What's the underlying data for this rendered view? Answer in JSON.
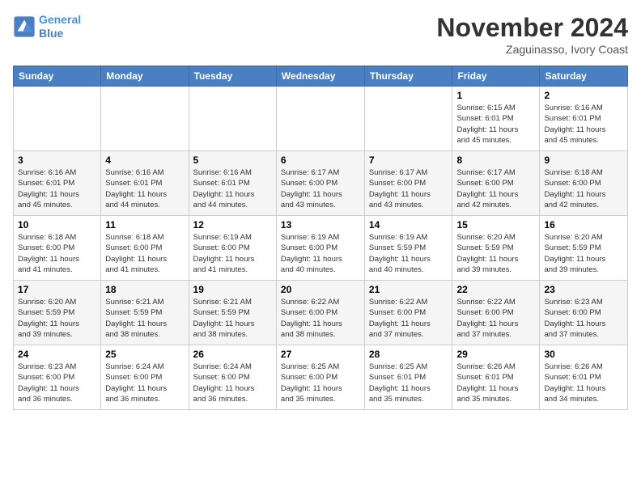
{
  "header": {
    "logo_line1": "General",
    "logo_line2": "Blue",
    "month_title": "November 2024",
    "location": "Zaguinasso, Ivory Coast"
  },
  "days_of_week": [
    "Sunday",
    "Monday",
    "Tuesday",
    "Wednesday",
    "Thursday",
    "Friday",
    "Saturday"
  ],
  "weeks": [
    [
      {
        "num": "",
        "info": ""
      },
      {
        "num": "",
        "info": ""
      },
      {
        "num": "",
        "info": ""
      },
      {
        "num": "",
        "info": ""
      },
      {
        "num": "",
        "info": ""
      },
      {
        "num": "1",
        "info": "Sunrise: 6:15 AM\nSunset: 6:01 PM\nDaylight: 11 hours\nand 45 minutes."
      },
      {
        "num": "2",
        "info": "Sunrise: 6:16 AM\nSunset: 6:01 PM\nDaylight: 11 hours\nand 45 minutes."
      }
    ],
    [
      {
        "num": "3",
        "info": "Sunrise: 6:16 AM\nSunset: 6:01 PM\nDaylight: 11 hours\nand 45 minutes."
      },
      {
        "num": "4",
        "info": "Sunrise: 6:16 AM\nSunset: 6:01 PM\nDaylight: 11 hours\nand 44 minutes."
      },
      {
        "num": "5",
        "info": "Sunrise: 6:16 AM\nSunset: 6:01 PM\nDaylight: 11 hours\nand 44 minutes."
      },
      {
        "num": "6",
        "info": "Sunrise: 6:17 AM\nSunset: 6:00 PM\nDaylight: 11 hours\nand 43 minutes."
      },
      {
        "num": "7",
        "info": "Sunrise: 6:17 AM\nSunset: 6:00 PM\nDaylight: 11 hours\nand 43 minutes."
      },
      {
        "num": "8",
        "info": "Sunrise: 6:17 AM\nSunset: 6:00 PM\nDaylight: 11 hours\nand 42 minutes."
      },
      {
        "num": "9",
        "info": "Sunrise: 6:18 AM\nSunset: 6:00 PM\nDaylight: 11 hours\nand 42 minutes."
      }
    ],
    [
      {
        "num": "10",
        "info": "Sunrise: 6:18 AM\nSunset: 6:00 PM\nDaylight: 11 hours\nand 41 minutes."
      },
      {
        "num": "11",
        "info": "Sunrise: 6:18 AM\nSunset: 6:00 PM\nDaylight: 11 hours\nand 41 minutes."
      },
      {
        "num": "12",
        "info": "Sunrise: 6:19 AM\nSunset: 6:00 PM\nDaylight: 11 hours\nand 41 minutes."
      },
      {
        "num": "13",
        "info": "Sunrise: 6:19 AM\nSunset: 6:00 PM\nDaylight: 11 hours\nand 40 minutes."
      },
      {
        "num": "14",
        "info": "Sunrise: 6:19 AM\nSunset: 5:59 PM\nDaylight: 11 hours\nand 40 minutes."
      },
      {
        "num": "15",
        "info": "Sunrise: 6:20 AM\nSunset: 5:59 PM\nDaylight: 11 hours\nand 39 minutes."
      },
      {
        "num": "16",
        "info": "Sunrise: 6:20 AM\nSunset: 5:59 PM\nDaylight: 11 hours\nand 39 minutes."
      }
    ],
    [
      {
        "num": "17",
        "info": "Sunrise: 6:20 AM\nSunset: 5:59 PM\nDaylight: 11 hours\nand 39 minutes."
      },
      {
        "num": "18",
        "info": "Sunrise: 6:21 AM\nSunset: 5:59 PM\nDaylight: 11 hours\nand 38 minutes."
      },
      {
        "num": "19",
        "info": "Sunrise: 6:21 AM\nSunset: 5:59 PM\nDaylight: 11 hours\nand 38 minutes."
      },
      {
        "num": "20",
        "info": "Sunrise: 6:22 AM\nSunset: 6:00 PM\nDaylight: 11 hours\nand 38 minutes."
      },
      {
        "num": "21",
        "info": "Sunrise: 6:22 AM\nSunset: 6:00 PM\nDaylight: 11 hours\nand 37 minutes."
      },
      {
        "num": "22",
        "info": "Sunrise: 6:22 AM\nSunset: 6:00 PM\nDaylight: 11 hours\nand 37 minutes."
      },
      {
        "num": "23",
        "info": "Sunrise: 6:23 AM\nSunset: 6:00 PM\nDaylight: 11 hours\nand 37 minutes."
      }
    ],
    [
      {
        "num": "24",
        "info": "Sunrise: 6:23 AM\nSunset: 6:00 PM\nDaylight: 11 hours\nand 36 minutes."
      },
      {
        "num": "25",
        "info": "Sunrise: 6:24 AM\nSunset: 6:00 PM\nDaylight: 11 hours\nand 36 minutes."
      },
      {
        "num": "26",
        "info": "Sunrise: 6:24 AM\nSunset: 6:00 PM\nDaylight: 11 hours\nand 36 minutes."
      },
      {
        "num": "27",
        "info": "Sunrise: 6:25 AM\nSunset: 6:00 PM\nDaylight: 11 hours\nand 35 minutes."
      },
      {
        "num": "28",
        "info": "Sunrise: 6:25 AM\nSunset: 6:01 PM\nDaylight: 11 hours\nand 35 minutes."
      },
      {
        "num": "29",
        "info": "Sunrise: 6:26 AM\nSunset: 6:01 PM\nDaylight: 11 hours\nand 35 minutes."
      },
      {
        "num": "30",
        "info": "Sunrise: 6:26 AM\nSunset: 6:01 PM\nDaylight: 11 hours\nand 34 minutes."
      }
    ]
  ]
}
